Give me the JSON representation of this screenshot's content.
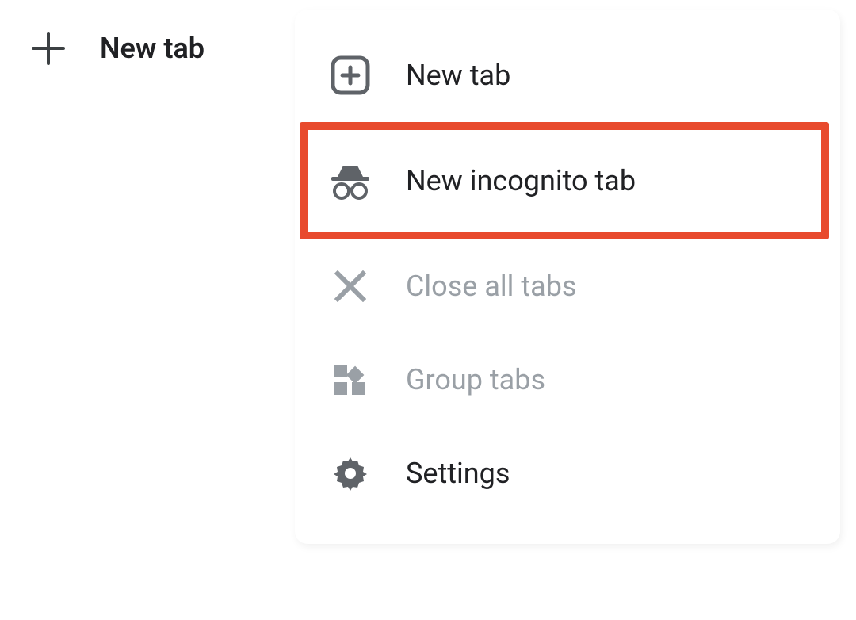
{
  "toolbar": {
    "new_tab_label": "New tab"
  },
  "menu": {
    "items": [
      {
        "label": "New tab"
      },
      {
        "label": "New incognito tab"
      },
      {
        "label": "Close all tabs"
      },
      {
        "label": "Group tabs"
      },
      {
        "label": "Settings"
      }
    ]
  }
}
